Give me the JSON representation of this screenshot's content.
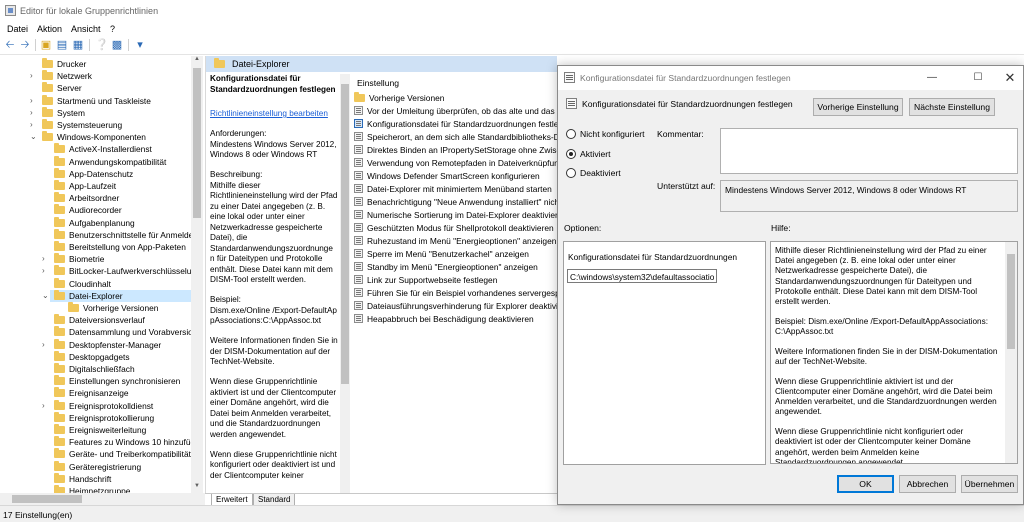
{
  "window": {
    "title": "Editor für lokale Gruppenrichtlinien"
  },
  "menu": [
    "Datei",
    "Aktion",
    "Ansicht",
    "?"
  ],
  "toolbar": {
    "icons": [
      "back-arrow-icon",
      "forward-arrow-icon",
      "up-folder-icon",
      "show-tree-icon",
      "properties-icon",
      "help-icon",
      "view-icon",
      "filter-icon"
    ]
  },
  "tree": {
    "items": [
      {
        "label": "Drucker",
        "level": 1
      },
      {
        "label": "Netzwerk",
        "level": 1,
        "expand": ">"
      },
      {
        "label": "Server",
        "level": 1
      },
      {
        "label": "Startmenü und Taskleiste",
        "level": 1,
        "expand": ">"
      },
      {
        "label": "System",
        "level": 1,
        "expand": ">"
      },
      {
        "label": "Systemsteuerung",
        "level": 1,
        "expand": ">"
      },
      {
        "label": "Windows-Komponenten",
        "level": 1,
        "expand": "v"
      },
      {
        "label": "ActiveX-Installerdienst",
        "level": 2
      },
      {
        "label": "Anwendungskompatibilität",
        "level": 2
      },
      {
        "label": "App-Datenschutz",
        "level": 2
      },
      {
        "label": "App-Laufzeit",
        "level": 2
      },
      {
        "label": "Arbeitsordner",
        "level": 2
      },
      {
        "label": "Audiorecorder",
        "level": 2
      },
      {
        "label": "Aufgabenplanung",
        "level": 2
      },
      {
        "label": "Benutzerschnittstelle für Anmelde",
        "level": 2
      },
      {
        "label": "Bereitstellung von App-Paketen",
        "level": 2
      },
      {
        "label": "Biometrie",
        "level": 2,
        "expand": ">"
      },
      {
        "label": "BitLocker-Laufwerkverschlüsselun",
        "level": 2,
        "expand": ">"
      },
      {
        "label": "Cloudinhalt",
        "level": 2
      },
      {
        "label": "Datei-Explorer",
        "level": 2,
        "expand": "v",
        "selected": true
      },
      {
        "label": "Vorherige Versionen",
        "level": 3
      },
      {
        "label": "Dateiversionsverlauf",
        "level": 2
      },
      {
        "label": "Datensammlung und Vorabversion",
        "level": 2
      },
      {
        "label": "Desktopfenster-Manager",
        "level": 2,
        "expand": ">"
      },
      {
        "label": "Desktopgadgets",
        "level": 2
      },
      {
        "label": "Digitalschließfach",
        "level": 2
      },
      {
        "label": "Einstellungen synchronisieren",
        "level": 2
      },
      {
        "label": "Ereignisanzeige",
        "level": 2
      },
      {
        "label": "Ereignisprotokolldienst",
        "level": 2,
        "expand": ">"
      },
      {
        "label": "Ereignisprotokollierung",
        "level": 2
      },
      {
        "label": "Ereignisweiterleitung",
        "level": 2
      },
      {
        "label": "Features zu Windows 10 hinzufüge",
        "level": 2
      },
      {
        "label": "Geräte- und Treiberkompatibilität",
        "level": 2
      },
      {
        "label": "Geräteregistrierung",
        "level": 2
      },
      {
        "label": "Handschrift",
        "level": 2
      },
      {
        "label": "Heimnetzgruppe",
        "level": 2
      }
    ]
  },
  "pane": {
    "header": "Datei-Explorer",
    "desc_title": "Konfigurationsdatei für Standardzuordnungen festlegen",
    "edit_link": "Richtlinieneinstellung bearbeiten",
    "req_label": "Anforderungen:",
    "req_text": "Mindestens Windows Server 2012, Windows 8 oder Windows RT",
    "desc_label": "Beschreibung:",
    "desc_text": "Mithilfe dieser Richtlinieneinstellung wird der Pfad zu einer Datei angegeben (z. B. eine lokal oder unter einer Netzwerkadresse gespeicherte Datei), die Standardanwendungszuordnunge n für Dateitypen und Protokolle enthält. Diese Datei kann mit dem DISM-Tool erstellt werden.",
    "example_label": "Beispiel:",
    "example_text": "Dism.exe/Online /Export-DefaultAppAssociations:C:\\AppAssoc.txt",
    "more_info": "Weitere Informationen finden Sie in der DISM-Dokumentation auf der TechNet-Website.",
    "enabled_text": "Wenn diese Gruppenrichtlinie aktiviert ist und der Clientcomputer einer Domäne angehört, wird die Datei beim Anmelden verarbeitet, und die Standardzuordnungen werden angewendet.",
    "notconf_text": "Wenn diese Gruppenrichtlinie nicht konfiguriert oder deaktiviert ist und der Clientcomputer keiner"
  },
  "list": {
    "header": "Einstellung",
    "items": [
      {
        "label": "Vorherige Versionen",
        "folder": true
      },
      {
        "label": "Vor der Umleitung überprüfen, ob das alte und das ne"
      },
      {
        "label": "Konfigurationsdatei für Standardzuordnungen festlege",
        "selected": true
      },
      {
        "label": "Speicherort, an dem sich alle Standardbibliotheks-Defi"
      },
      {
        "label": "Direktes Binden an IPropertySetStorage ohne Zwischen"
      },
      {
        "label": "Verwendung von Remotepfaden in Dateiverknüpfungs"
      },
      {
        "label": "Windows Defender SmartScreen konfigurieren"
      },
      {
        "label": "Datei-Explorer mit minimiertem Menüband starten"
      },
      {
        "label": "Benachrichtigung \"Neue Anwendung installiert\" nicht"
      },
      {
        "label": "Numerische Sortierung im Datei-Explorer deaktivieren"
      },
      {
        "label": "Geschützten Modus für Shellprotokoll deaktivieren"
      },
      {
        "label": "Ruhezustand im Menü \"Energieoptionen\" anzeigen"
      },
      {
        "label": "Sperre im Menü \"Benutzerkachel\" anzeigen"
      },
      {
        "label": "Standby im Menü \"Energieoptionen\" anzeigen"
      },
      {
        "label": "Link zur Supportwebseite festlegen"
      },
      {
        "label": "Führen Sie für ein Beispiel vorhandenes servergespeiche"
      },
      {
        "label": "Dateiausführungsverhinderung für Explorer deaktivier"
      },
      {
        "label": "Heapabbruch bei Beschädigung deaktivieren"
      }
    ]
  },
  "tabs": [
    "Erweitert",
    "Standard"
  ],
  "status": "17 Einstellung(en)",
  "dialog": {
    "title": "Konfigurationsdatei für Standardzuordnungen festlegen",
    "heading": "Konfigurationsdatei für Standardzuordnungen festlegen",
    "prev_button": "Vorherige Einstellung",
    "next_button": "Nächste Einstellung",
    "radio_notconf": "Nicht konfiguriert",
    "radio_enabled": "Aktiviert",
    "radio_disabled": "Deaktiviert",
    "comment_label": "Kommentar:",
    "comment_value": "",
    "supported_label": "Unterstützt auf:",
    "supported_value": "Mindestens Windows Server 2012, Windows 8 oder Windows RT",
    "options_label": "Optionen:",
    "help_label": "Hilfe:",
    "option_field_label": "Konfigurationsdatei für Standardzuordnungen",
    "option_field_value": "C:\\windows\\system32\\defaultassociatio",
    "help_p1": "Mithilfe dieser Richtlinieneinstellung wird der Pfad zu einer Datei angegeben (z. B. eine lokal oder unter einer Netzwerkadresse gespeicherte Datei), die Standardanwendungszuordnungen für Dateitypen und Protokolle enthält. Diese Datei kann mit dem DISM-Tool erstellt werden.",
    "help_p2": "Beispiel: Dism.exe/Online /Export-DefaultAppAssociations:C:\\AppAssoc.txt",
    "help_p3": "Weitere Informationen finden Sie in der DISM-Dokumentation auf der TechNet-Website.",
    "help_p4": "Wenn diese Gruppenrichtlinie aktiviert ist und der Clientcomputer einer Domäne angehört, wird die Datei beim Anmelden verarbeitet, und die Standardzuordnungen werden angewendet.",
    "help_p5": "Wenn diese Gruppenrichtlinie nicht konfiguriert oder deaktiviert ist oder der Clientcomputer keiner Domäne angehört, werden beim Anmelden keine Standardzuordnungen angewendet.",
    "ok": "OK",
    "cancel": "Abbrechen",
    "apply": "Übernehmen",
    "selected_radio": "enabled"
  }
}
